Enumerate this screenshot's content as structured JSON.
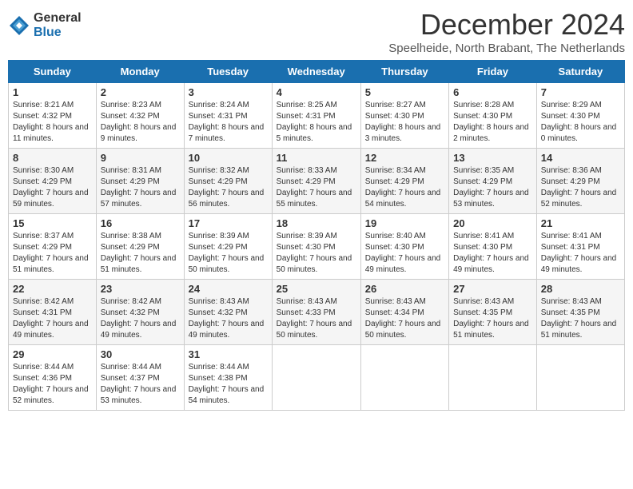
{
  "header": {
    "logo_general": "General",
    "logo_blue": "Blue",
    "title": "December 2024",
    "location": "Speelheide, North Brabant, The Netherlands"
  },
  "weekdays": [
    "Sunday",
    "Monday",
    "Tuesday",
    "Wednesday",
    "Thursday",
    "Friday",
    "Saturday"
  ],
  "weeks": [
    [
      {
        "day": "1",
        "sunrise": "8:21 AM",
        "sunset": "4:32 PM",
        "daylight": "8 hours and 11 minutes."
      },
      {
        "day": "2",
        "sunrise": "8:23 AM",
        "sunset": "4:32 PM",
        "daylight": "8 hours and 9 minutes."
      },
      {
        "day": "3",
        "sunrise": "8:24 AM",
        "sunset": "4:31 PM",
        "daylight": "8 hours and 7 minutes."
      },
      {
        "day": "4",
        "sunrise": "8:25 AM",
        "sunset": "4:31 PM",
        "daylight": "8 hours and 5 minutes."
      },
      {
        "day": "5",
        "sunrise": "8:27 AM",
        "sunset": "4:30 PM",
        "daylight": "8 hours and 3 minutes."
      },
      {
        "day": "6",
        "sunrise": "8:28 AM",
        "sunset": "4:30 PM",
        "daylight": "8 hours and 2 minutes."
      },
      {
        "day": "7",
        "sunrise": "8:29 AM",
        "sunset": "4:30 PM",
        "daylight": "8 hours and 0 minutes."
      }
    ],
    [
      {
        "day": "8",
        "sunrise": "8:30 AM",
        "sunset": "4:29 PM",
        "daylight": "7 hours and 59 minutes."
      },
      {
        "day": "9",
        "sunrise": "8:31 AM",
        "sunset": "4:29 PM",
        "daylight": "7 hours and 57 minutes."
      },
      {
        "day": "10",
        "sunrise": "8:32 AM",
        "sunset": "4:29 PM",
        "daylight": "7 hours and 56 minutes."
      },
      {
        "day": "11",
        "sunrise": "8:33 AM",
        "sunset": "4:29 PM",
        "daylight": "7 hours and 55 minutes."
      },
      {
        "day": "12",
        "sunrise": "8:34 AM",
        "sunset": "4:29 PM",
        "daylight": "7 hours and 54 minutes."
      },
      {
        "day": "13",
        "sunrise": "8:35 AM",
        "sunset": "4:29 PM",
        "daylight": "7 hours and 53 minutes."
      },
      {
        "day": "14",
        "sunrise": "8:36 AM",
        "sunset": "4:29 PM",
        "daylight": "7 hours and 52 minutes."
      }
    ],
    [
      {
        "day": "15",
        "sunrise": "8:37 AM",
        "sunset": "4:29 PM",
        "daylight": "7 hours and 51 minutes."
      },
      {
        "day": "16",
        "sunrise": "8:38 AM",
        "sunset": "4:29 PM",
        "daylight": "7 hours and 51 minutes."
      },
      {
        "day": "17",
        "sunrise": "8:39 AM",
        "sunset": "4:29 PM",
        "daylight": "7 hours and 50 minutes."
      },
      {
        "day": "18",
        "sunrise": "8:39 AM",
        "sunset": "4:30 PM",
        "daylight": "7 hours and 50 minutes."
      },
      {
        "day": "19",
        "sunrise": "8:40 AM",
        "sunset": "4:30 PM",
        "daylight": "7 hours and 49 minutes."
      },
      {
        "day": "20",
        "sunrise": "8:41 AM",
        "sunset": "4:30 PM",
        "daylight": "7 hours and 49 minutes."
      },
      {
        "day": "21",
        "sunrise": "8:41 AM",
        "sunset": "4:31 PM",
        "daylight": "7 hours and 49 minutes."
      }
    ],
    [
      {
        "day": "22",
        "sunrise": "8:42 AM",
        "sunset": "4:31 PM",
        "daylight": "7 hours and 49 minutes."
      },
      {
        "day": "23",
        "sunrise": "8:42 AM",
        "sunset": "4:32 PM",
        "daylight": "7 hours and 49 minutes."
      },
      {
        "day": "24",
        "sunrise": "8:43 AM",
        "sunset": "4:32 PM",
        "daylight": "7 hours and 49 minutes."
      },
      {
        "day": "25",
        "sunrise": "8:43 AM",
        "sunset": "4:33 PM",
        "daylight": "7 hours and 50 minutes."
      },
      {
        "day": "26",
        "sunrise": "8:43 AM",
        "sunset": "4:34 PM",
        "daylight": "7 hours and 50 minutes."
      },
      {
        "day": "27",
        "sunrise": "8:43 AM",
        "sunset": "4:35 PM",
        "daylight": "7 hours and 51 minutes."
      },
      {
        "day": "28",
        "sunrise": "8:43 AM",
        "sunset": "4:35 PM",
        "daylight": "7 hours and 51 minutes."
      }
    ],
    [
      {
        "day": "29",
        "sunrise": "8:44 AM",
        "sunset": "4:36 PM",
        "daylight": "7 hours and 52 minutes."
      },
      {
        "day": "30",
        "sunrise": "8:44 AM",
        "sunset": "4:37 PM",
        "daylight": "7 hours and 53 minutes."
      },
      {
        "day": "31",
        "sunrise": "8:44 AM",
        "sunset": "4:38 PM",
        "daylight": "7 hours and 54 minutes."
      },
      null,
      null,
      null,
      null
    ]
  ]
}
